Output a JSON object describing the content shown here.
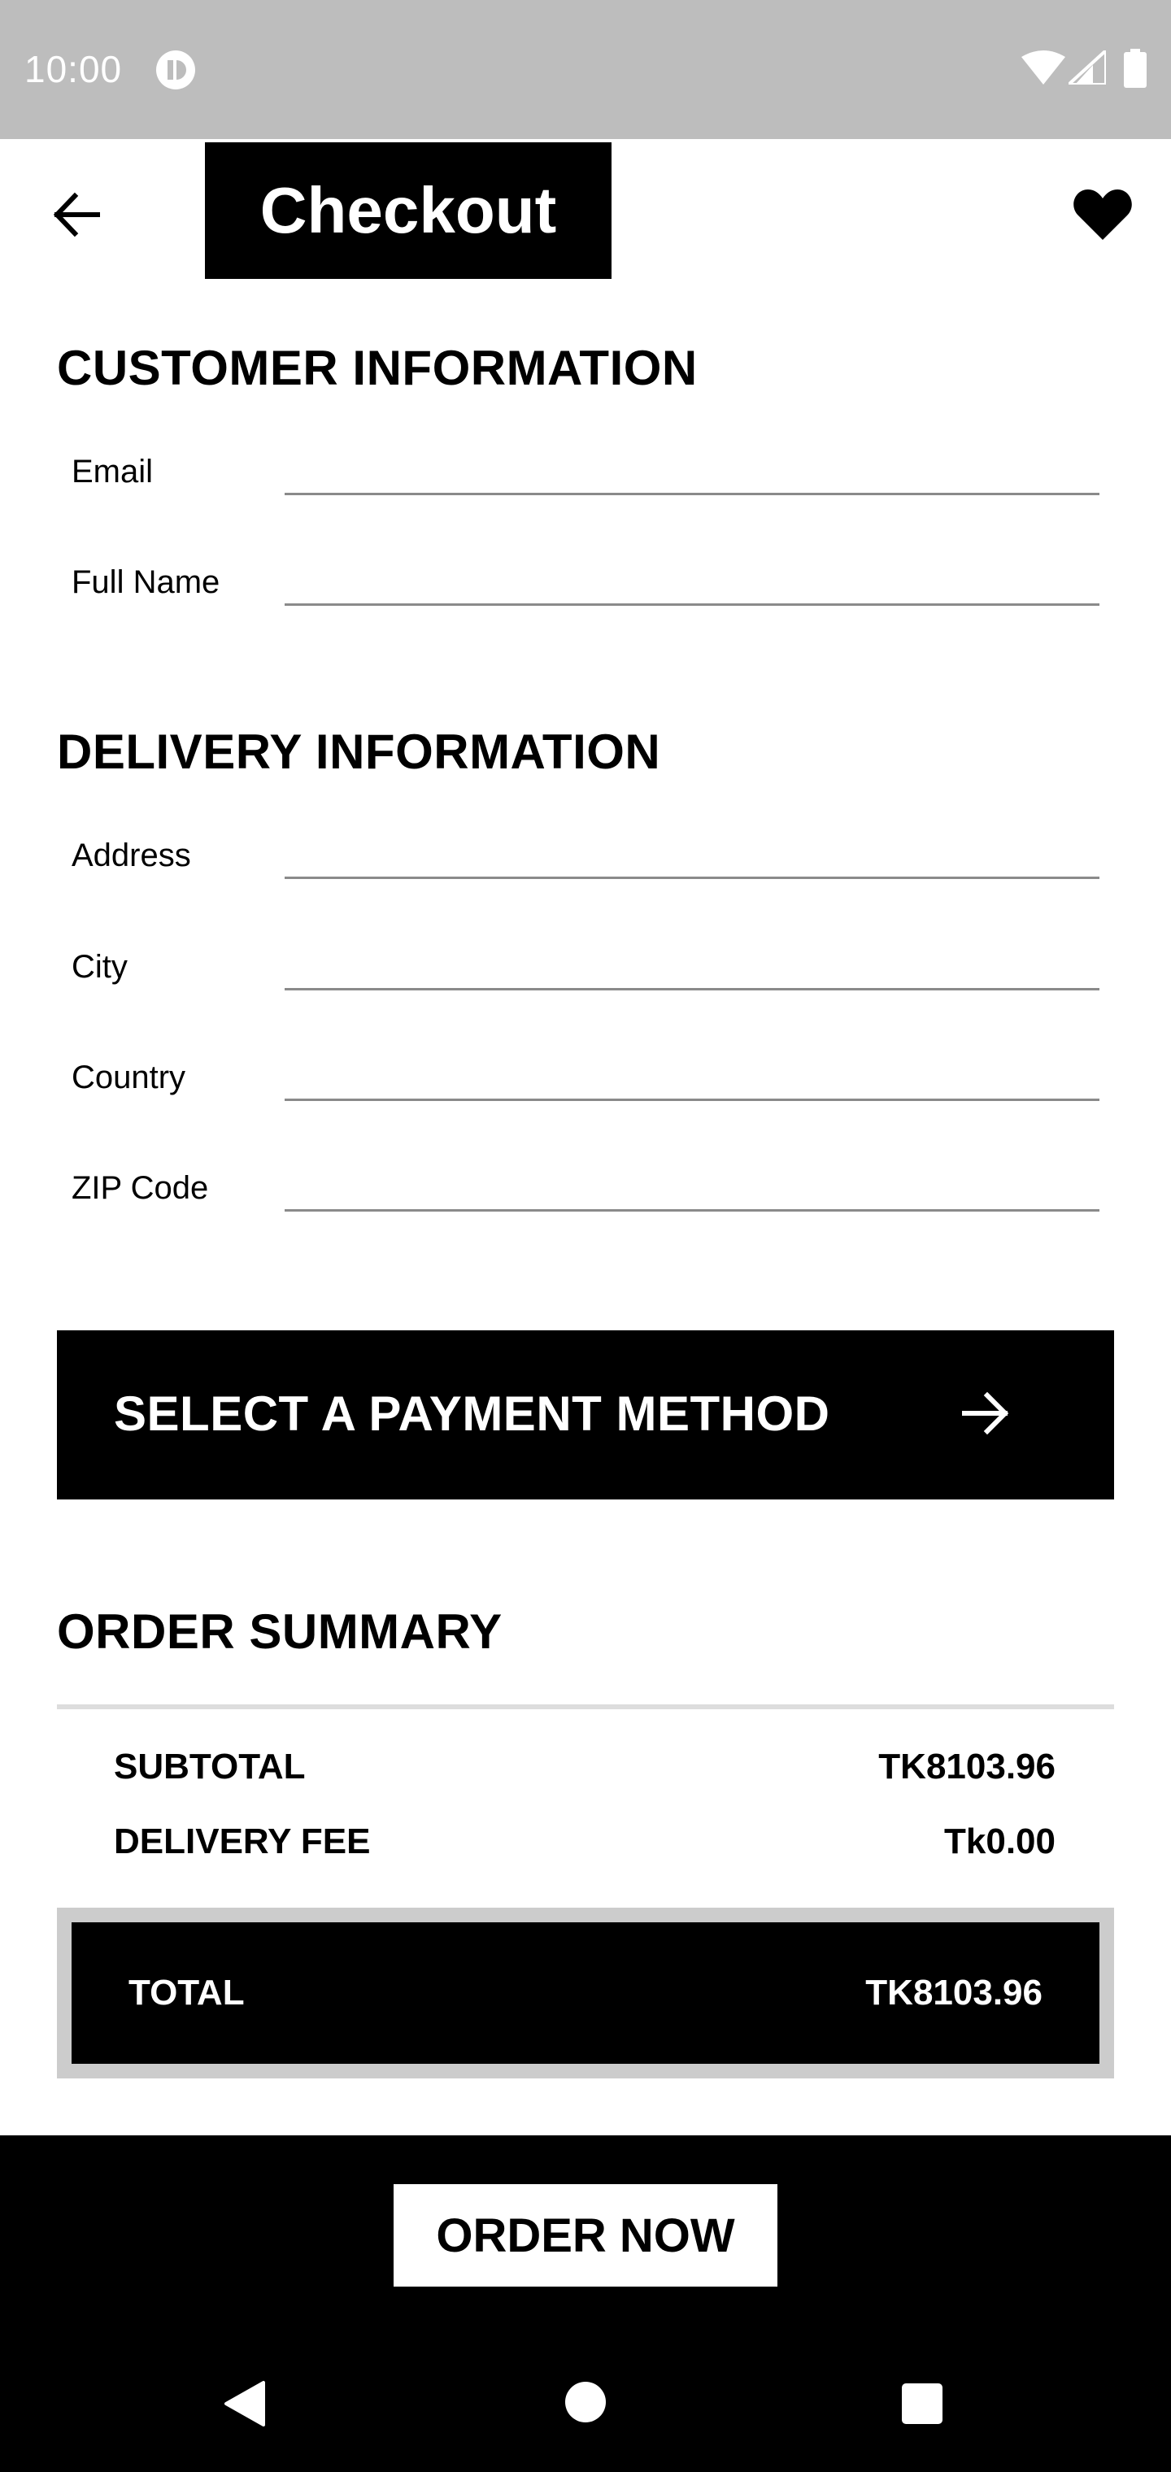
{
  "status_bar": {
    "time": "10:00",
    "icons": [
      "app-notification-icon",
      "wifi-icon",
      "cell-signal-icon",
      "battery-icon"
    ]
  },
  "app_bar": {
    "title": "Checkout",
    "back_icon": "arrow-left-icon",
    "favorite_icon": "heart-icon"
  },
  "customer_info": {
    "heading": "CUSTOMER INFORMATION",
    "fields": [
      {
        "label": "Email",
        "value": ""
      },
      {
        "label": "Full Name",
        "value": ""
      }
    ]
  },
  "delivery_info": {
    "heading": "DELIVERY INFORMATION",
    "fields": [
      {
        "label": "Address",
        "value": ""
      },
      {
        "label": "City",
        "value": ""
      },
      {
        "label": "Country",
        "value": ""
      },
      {
        "label": "ZIP Code",
        "value": ""
      }
    ]
  },
  "payment": {
    "label": "SELECT A PAYMENT METHOD",
    "icon": "arrow-right-icon"
  },
  "order_summary": {
    "heading": "ORDER SUMMARY",
    "subtotal_label": "SUBTOTAL",
    "subtotal_value": "TK8103.96",
    "delivery_fee_label": "DELIVERY FEE",
    "delivery_fee_value": "Tk0.00",
    "total_label": "TOTAL",
    "total_value": "TK8103.96"
  },
  "order_button": {
    "label": "ORDER NOW"
  },
  "nav_bar": {
    "icons": [
      "nav-back-icon",
      "nav-home-icon",
      "nav-recents-icon"
    ]
  },
  "colors": {
    "status_bar": "#bdbdbd",
    "primary": "#000000",
    "background": "#ffffff",
    "divider": "#dddddd",
    "total_frame": "#cccccc"
  }
}
